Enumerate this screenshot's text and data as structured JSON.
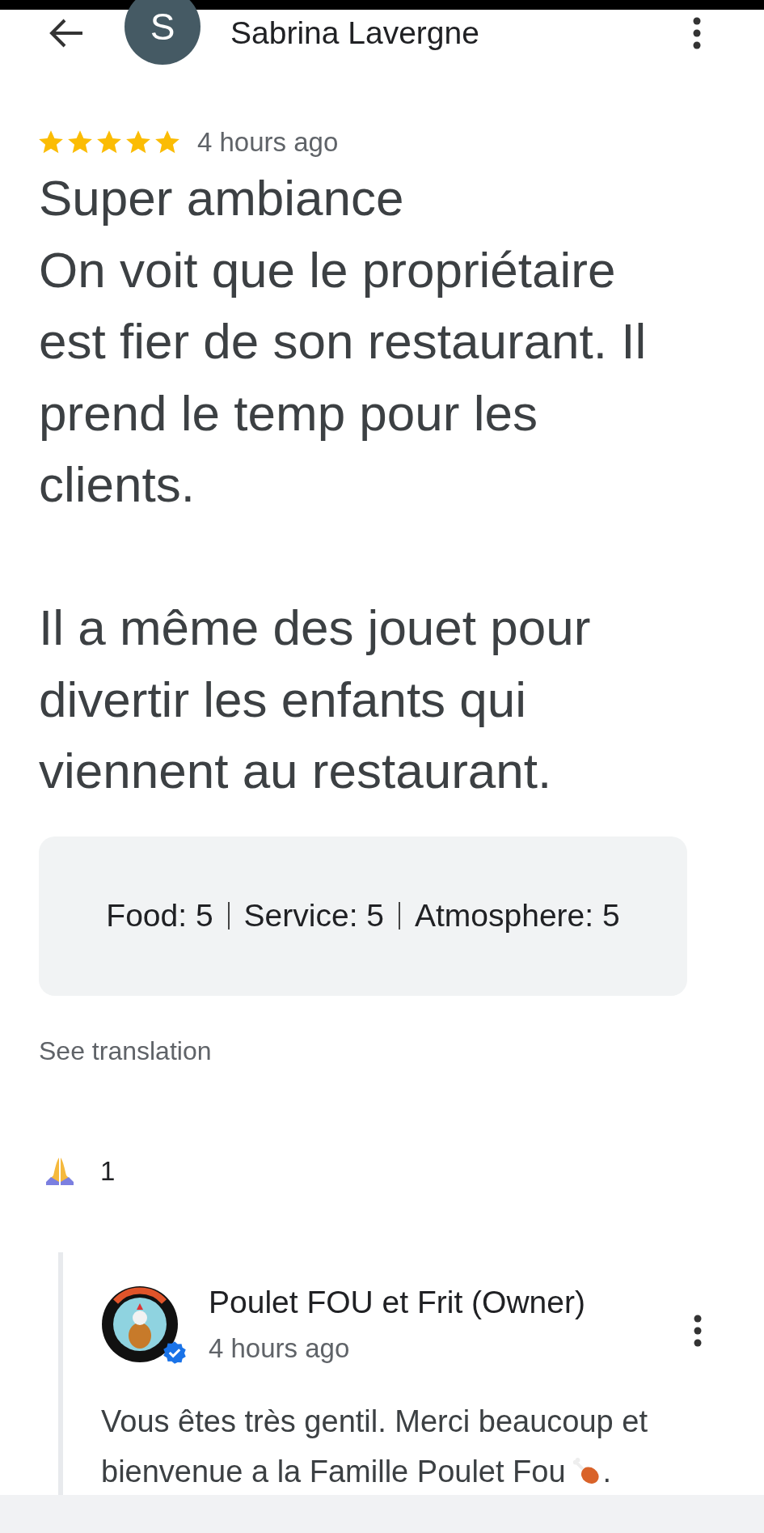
{
  "header": {
    "avatar_letter": "S",
    "name": "Sabrina Lavergne"
  },
  "review": {
    "stars": 5,
    "time": "4 hours ago",
    "text": "Super ambiance\nOn voit que le propriétaire\nest fier de son restaurant. Il\nprend le temp pour les\nclients.\n\nIl a même des jouet pour\ndivertir les enfants qui\nviennent au restaurant."
  },
  "ratings": [
    {
      "label": "Food:",
      "value": "5"
    },
    {
      "label": "Service:",
      "value": "5"
    },
    {
      "label": "Atmosphere:",
      "value": "5"
    }
  ],
  "see_translation": "See translation",
  "reaction": {
    "count": "1"
  },
  "reply": {
    "name": "Poulet FOU et Frit (Owner)",
    "verified": true,
    "time": "4 hours ago",
    "lines": [
      "Vous êtes très gentil. Merci beaucoup et",
      "bienvenue a la Famille Poulet Fou"
    ],
    "end": "."
  }
}
